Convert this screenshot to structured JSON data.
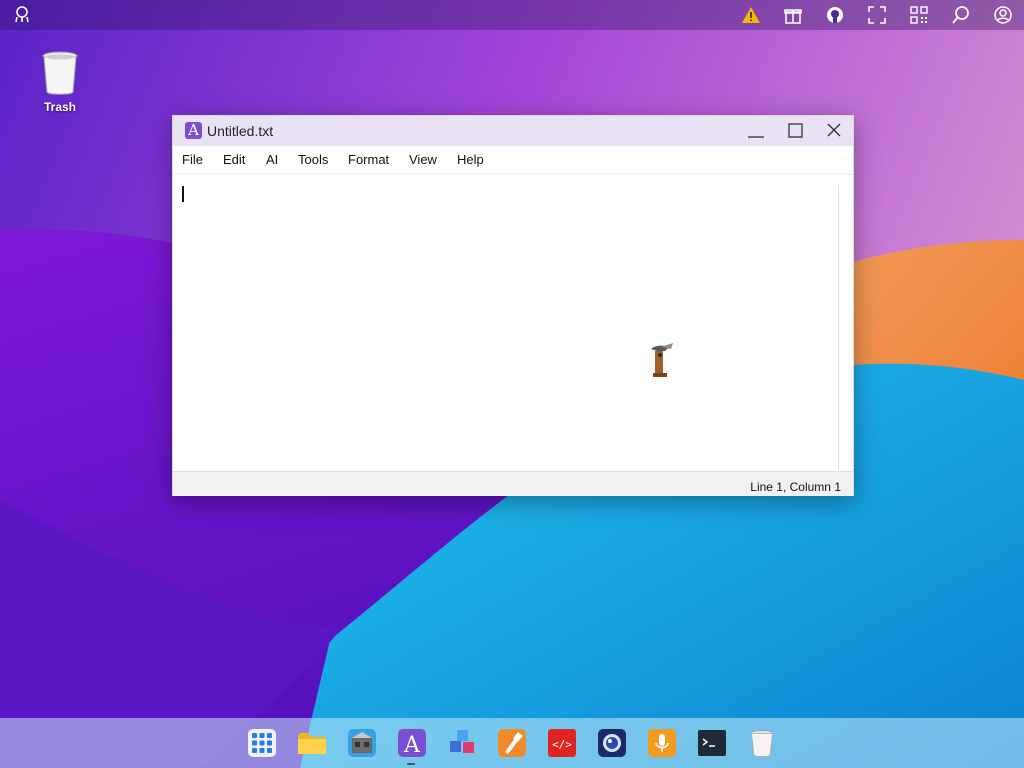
{
  "desktop": {
    "trash_label": "Trash"
  },
  "topbar": {
    "icons": [
      "logo-icon",
      "warning-icon",
      "gift-icon",
      "github-icon",
      "fullscreen-icon",
      "qr-code-icon",
      "search-icon",
      "user-icon"
    ]
  },
  "window": {
    "title": "Untitled.txt",
    "app_icon_letter": "A",
    "menu": [
      "File",
      "Edit",
      "AI",
      "Tools",
      "Format",
      "View",
      "Help"
    ],
    "editor_text": "",
    "status": "Line 1, Column 1"
  },
  "dock": {
    "items": [
      "app-launcher-icon",
      "files-icon",
      "store-icon",
      "text-editor-icon",
      "blocks-icon",
      "paint-icon",
      "code-editor-icon",
      "camera-icon",
      "recorder-icon",
      "terminal-icon",
      "trash-icon"
    ],
    "active_item": "text-editor-icon"
  },
  "colors": {
    "window_titlebar": "#e9e2f5",
    "accent_purple": "#7b4fd1",
    "warning": "#f5b800"
  }
}
